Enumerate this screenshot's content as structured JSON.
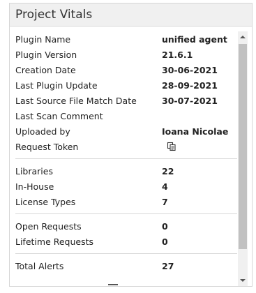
{
  "panel": {
    "title": "Project Vitals"
  },
  "groups": [
    [
      {
        "label": "Plugin Name",
        "value": "unified agent"
      },
      {
        "label": "Plugin Version",
        "value": "21.6.1"
      },
      {
        "label": "Creation Date",
        "value": "30-06-2021"
      },
      {
        "label": "Last Plugin Update",
        "value": "28-09-2021"
      },
      {
        "label": "Last Source File Match Date",
        "value": "30-07-2021"
      },
      {
        "label": "Last Scan Comment",
        "value": ""
      },
      {
        "label": "Uploaded by",
        "value": "Ioana Nicolae"
      },
      {
        "label": "Request Token",
        "value": "",
        "icon": "copy-icon"
      }
    ],
    [
      {
        "label": "Libraries",
        "value": "22"
      },
      {
        "label": "In-House",
        "value": "4"
      },
      {
        "label": "License Types",
        "value": "7"
      }
    ],
    [
      {
        "label": "Open Requests",
        "value": "0"
      },
      {
        "label": "Lifetime Requests",
        "value": "0"
      }
    ],
    [
      {
        "label": "Total Alerts",
        "value": "27"
      }
    ]
  ]
}
